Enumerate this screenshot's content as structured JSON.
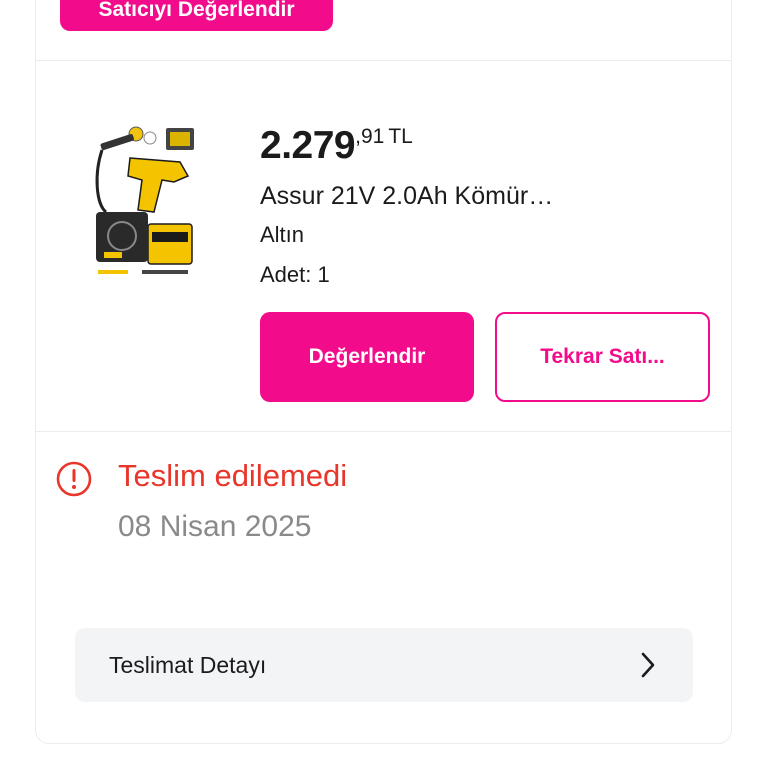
{
  "seller": {
    "rate_button_label": "Satıcıyı Değerlendir"
  },
  "product": {
    "price_main": "2.279",
    "price_fraction": ",91",
    "currency": "TL",
    "name": "Assur 21V 2.0Ah Kömür…",
    "variant": "Altın",
    "quantity": "Adet: 1",
    "rate_button_label": "Değerlendir",
    "rebuy_button_label": "Tekrar Satı..."
  },
  "delivery": {
    "status_text": "Teslim edilemedi",
    "status_date": "08 Nisan 2025",
    "detail_label": "Teslimat Detayı"
  },
  "icons": {
    "status": "alert-circle-icon",
    "detail": "chevron-right-icon"
  },
  "colors": {
    "brand_pink": "#f20c8c",
    "error_red": "#e8362b",
    "muted_gray": "#8a8a8a",
    "panel_gray": "#f3f4f6"
  }
}
